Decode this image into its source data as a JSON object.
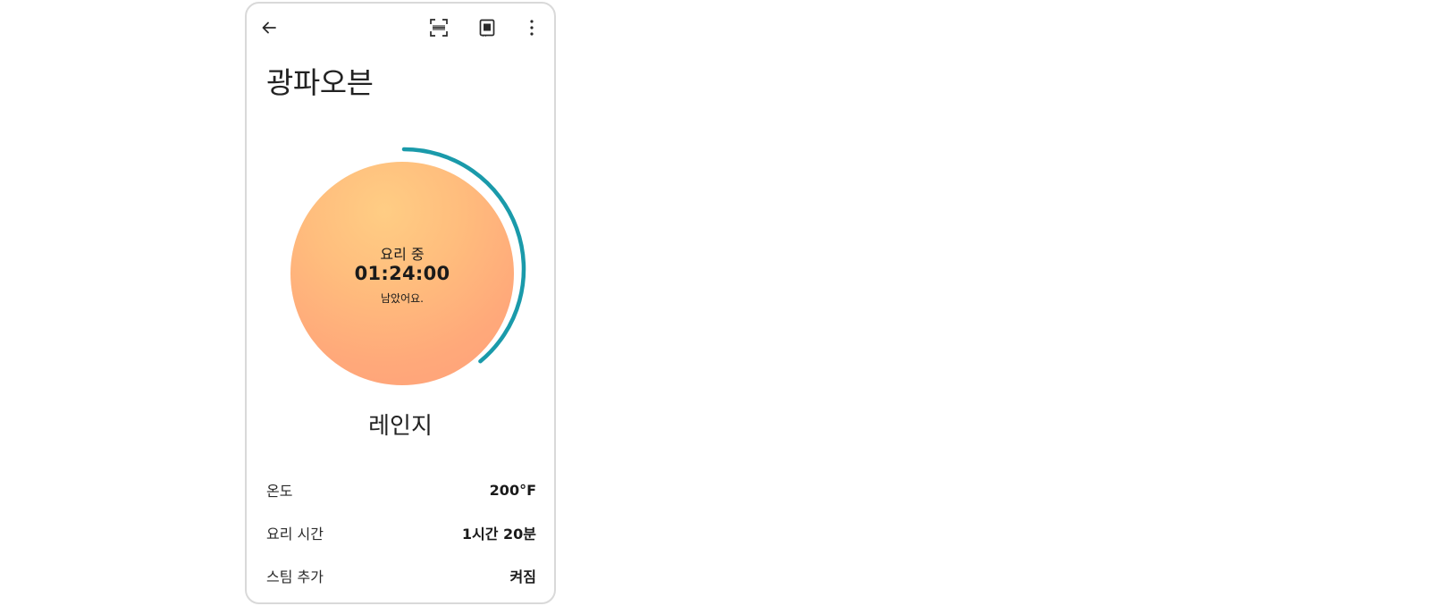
{
  "app": {
    "title": "광파오븐"
  },
  "toolbar": {
    "back_icon": "arrow-left-icon",
    "scan_icon": "scan-icon",
    "recipe_icon": "recipe-book-icon",
    "more_icon": "more-vertical-icon"
  },
  "cooking": {
    "status": "요리 중",
    "time_remaining": "01:24:00",
    "remaining_label": "남았어요.",
    "progress_fraction": 0.39,
    "mode": "레인지"
  },
  "settings": [
    {
      "label": "온도",
      "value": "200°F"
    },
    {
      "label": "요리 시간",
      "value": "1시간 20분"
    },
    {
      "label": "스팀 추가",
      "value": "켜짐"
    }
  ],
  "colors": {
    "progress_ring": "#1a9aaa",
    "orb_top": "#ffcd84",
    "orb_bottom": "#ff9f7a",
    "frame_border": "#d9d9d9"
  }
}
